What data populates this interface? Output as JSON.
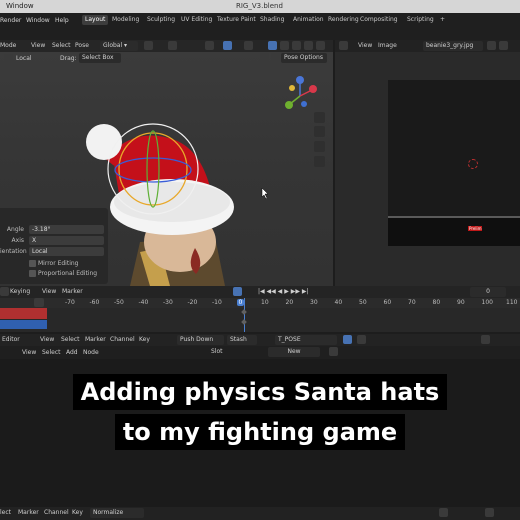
{
  "titlebar": {
    "window_menu": "Window",
    "file": "RIG_V3.blend"
  },
  "menu": {
    "render": "Render",
    "window": "Window",
    "help": "Help"
  },
  "workspaces": [
    "Layout",
    "Modeling",
    "Sculpting",
    "UV Editing",
    "Texture Paint",
    "Shading",
    "Animation",
    "Rendering",
    "Compositing",
    "Scripting",
    "+"
  ],
  "viewport_header": {
    "mode": "Mode",
    "view": "View",
    "select": "Select",
    "pose": "Pose",
    "orientation": "Global",
    "local": "Local",
    "drag_label": "Drag:",
    "drag_value": "Select Box",
    "pose_options": "Pose Options"
  },
  "image_editor": {
    "view": "View",
    "image": "Image",
    "filename": "beanie3_gry.jpg",
    "badge": "Prelim"
  },
  "operator_panel": {
    "angle_label": "Angle",
    "angle_value": "-3.18°",
    "axis_label": "Axis",
    "axis_value": "X",
    "orientation_label": "ientation",
    "orientation_value": "Local",
    "mirror_editing": "Mirror Editing",
    "proportional_editing": "Proportional Editing"
  },
  "timeline": {
    "keying": "Keying",
    "view": "View",
    "marker": "Marker",
    "current_frame": "0",
    "ticks": [
      "-70",
      "-60",
      "-50",
      "-40",
      "-30",
      "-20",
      "-10",
      "0",
      "10",
      "20",
      "30",
      "40",
      "50",
      "60",
      "70",
      "80",
      "90",
      "100",
      "110"
    ]
  },
  "nla": {
    "editor": "Editor",
    "view": "View",
    "select": "Select",
    "marker": "Marker",
    "channel": "Channel",
    "key": "Key",
    "push_down": "Push Down",
    "stash": "Stash",
    "action": "T_POSE",
    "slot": "Slot",
    "new": "New",
    "row2_view": "View",
    "row2_select": "Select",
    "row2_add": "Add",
    "row2_node": "Node"
  },
  "bottom": {
    "select": "lect",
    "marker": "Marker",
    "channel": "Channel",
    "key": "Key",
    "normalize": "Normalize"
  },
  "caption": {
    "line1": "Adding physics Santa hats",
    "line2": "to my fighting game"
  },
  "colors": {
    "accent": "#4772b3",
    "hat_red": "#d01717",
    "playhead": "#4a7fd1"
  }
}
